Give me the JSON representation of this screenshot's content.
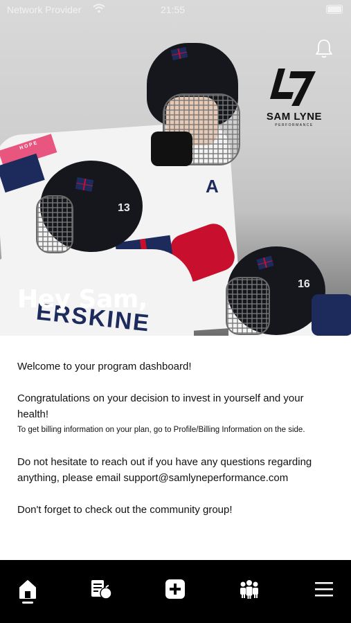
{
  "status_bar": {
    "carrier": "Network Provider",
    "time": "21:55"
  },
  "hero": {
    "greeting": "Hey Sam,",
    "jersey_name": "ERSKINE",
    "player_numbers": [
      "13",
      "16"
    ],
    "captain_letter": "A",
    "sleeve_text": "HOPE",
    "logo_text": "SAM LYNE",
    "logo_subtext": "PERFORMANCE"
  },
  "content": {
    "welcome": "Welcome to your program dashboard!",
    "congrats": "Congratulations on your decision to invest in yourself and your health!",
    "billing_note": "To get billing information on your plan, go to Profile/Billing Information on the side.",
    "contact": "Do not hesitate to reach out if you have any questions regarding anything, please email support@samlyneperformance.com",
    "community": "Don't forget to check out the community group!"
  },
  "tabbar": {
    "items": [
      {
        "icon": "home-icon"
      },
      {
        "icon": "nutrition-icon"
      },
      {
        "icon": "add-icon"
      },
      {
        "icon": "community-icon"
      },
      {
        "icon": "menu-icon"
      }
    ],
    "active_index": 0
  },
  "colors": {
    "tabbar_bg": "#000000",
    "text": "#111111",
    "hero_text": "#ffffff",
    "jersey_red": "#c8102e",
    "jersey_navy": "#1d2b5c"
  }
}
